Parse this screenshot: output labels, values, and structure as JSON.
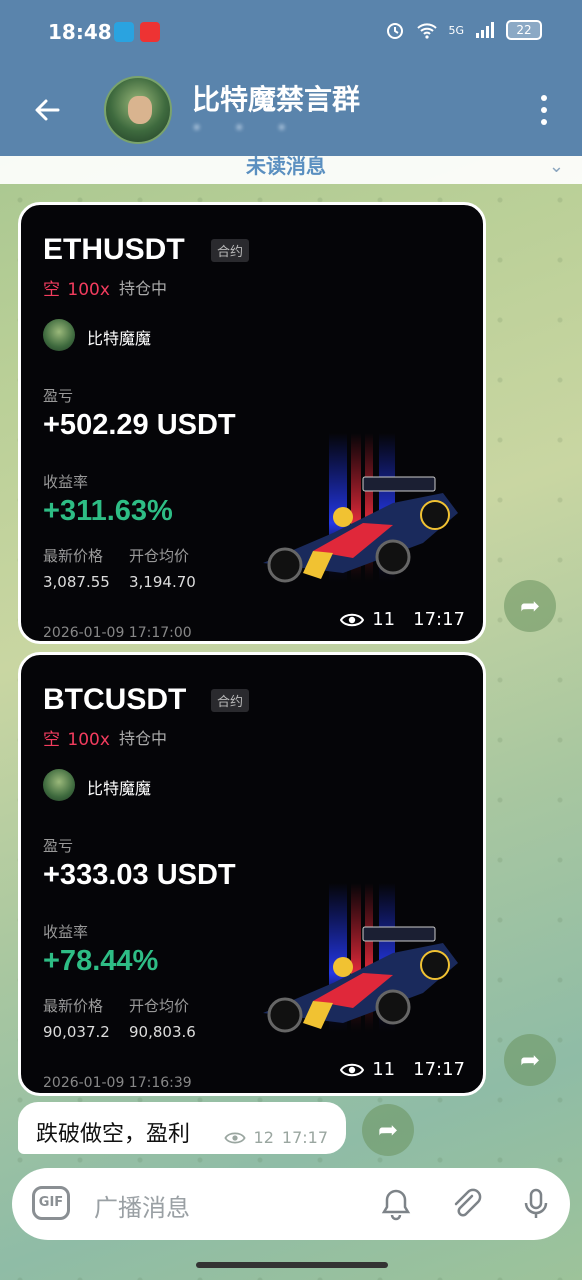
{
  "status": {
    "time": "18:48",
    "battery": "22",
    "signal": "5G"
  },
  "header": {
    "title": "比特魔禁言群",
    "subtitle": "• • •",
    "back_icon": "arrow-left-icon",
    "more_icon": "more-vertical-icon"
  },
  "unread": {
    "label": "未读消息"
  },
  "cards": [
    {
      "symbol": "ETHUSDT",
      "tag": "合约",
      "direction": "空",
      "leverage": "100x",
      "status": "持仓中",
      "trader": "比特魔魔",
      "pnl_label": "盈亏",
      "pnl": "+502.29 USDT",
      "roi_label": "收益率",
      "roi": "+311.63%",
      "latest_label": "最新价格",
      "entry_label": "开仓均价",
      "latest": "3,087.55",
      "entry": "3,194.70",
      "timestamp": "2026-01-09 17:17:00",
      "views": "11",
      "time": "17:17"
    },
    {
      "symbol": "BTCUSDT",
      "tag": "合约",
      "direction": "空",
      "leverage": "100x",
      "status": "持仓中",
      "trader": "比特魔魔",
      "pnl_label": "盈亏",
      "pnl": "+333.03 USDT",
      "roi_label": "收益率",
      "roi": "+78.44%",
      "latest_label": "最新价格",
      "entry_label": "开仓均价",
      "latest": "90,037.2",
      "entry": "90,803.6",
      "timestamp": "2026-01-09 17:16:39",
      "views": "11",
      "time": "17:17"
    }
  ],
  "message": {
    "text": "跌破做空，盈利",
    "views": "12",
    "time": "17:17"
  },
  "composer": {
    "gif": "GIF",
    "placeholder": "广播消息"
  },
  "colors": {
    "header": "#5a84ac",
    "short": "#f23c5e",
    "profit": "#2ebd85"
  }
}
